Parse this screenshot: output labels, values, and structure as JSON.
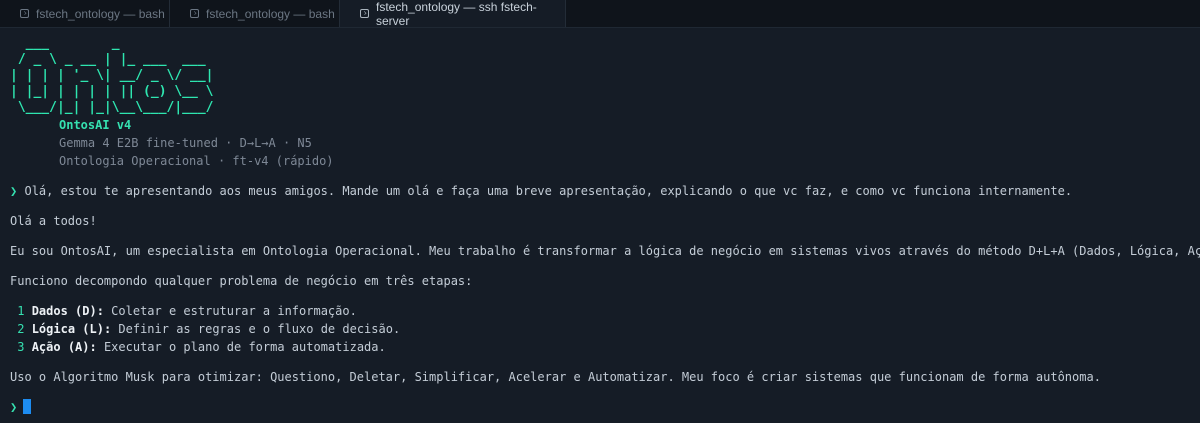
{
  "tabs": [
    {
      "label": "fstech_ontology — bash",
      "active": false
    },
    {
      "label": "fstech_ontology — bash",
      "active": false
    },
    {
      "label": "fstech_ontology — ssh fstech-server",
      "active": true
    }
  ],
  "logo": {
    "lines": [
      "  ___        _",
      " / _ \\ _ __ | |_ ___  ___",
      "| | | | '_ \\| __/ _ \\/ __|",
      "| |_| | | | | || (_) \\__ \\",
      " \\___/|_| |_|\\__\\___/|___/"
    ],
    "color": "#2ee6b0"
  },
  "banner": {
    "name": "OntosAI v4",
    "model": "Gemma 4 E2B fine-tuned · D→L→A · N5",
    "mode": "Ontologia Operacional · ft-v4 (rápido)"
  },
  "prompt_symbol": "❯",
  "user_message": "Olá, estou te apresentando aos meus amigos. Mande um olá e faça uma breve apresentação, explicando o que vc faz, e como vc funciona internamente.",
  "response": {
    "greeting": "Olá a todos!",
    "intro": "Eu sou OntosAI, um especialista em Ontologia Operacional. Meu trabalho é transformar a lógica de negócio em sistemas vivos através do método D+L+A (Dados, Lógica, Ação).",
    "steps_intro": "Funciono decompondo qualquer problema de negócio em três etapas:",
    "steps": [
      {
        "num": "1",
        "title": "Dados (D):",
        "text": " Coletar e estruturar a informação."
      },
      {
        "num": "2",
        "title": "Lógica (L):",
        "text": " Definir as regras e o fluxo de decisão."
      },
      {
        "num": "3",
        "title": "Ação (A):",
        "text": " Executar o plano de forma automatizada."
      }
    ],
    "closing": "Uso o Algoritmo Musk para otimizar: Questiono, Deletar, Simplificar, Acelerar e Automatizar. Meu foco é criar sistemas que funcionam de forma autônoma."
  },
  "colors": {
    "accent": "#35e0b0",
    "cursor": "#1d8cf0",
    "background": "#151c26"
  }
}
